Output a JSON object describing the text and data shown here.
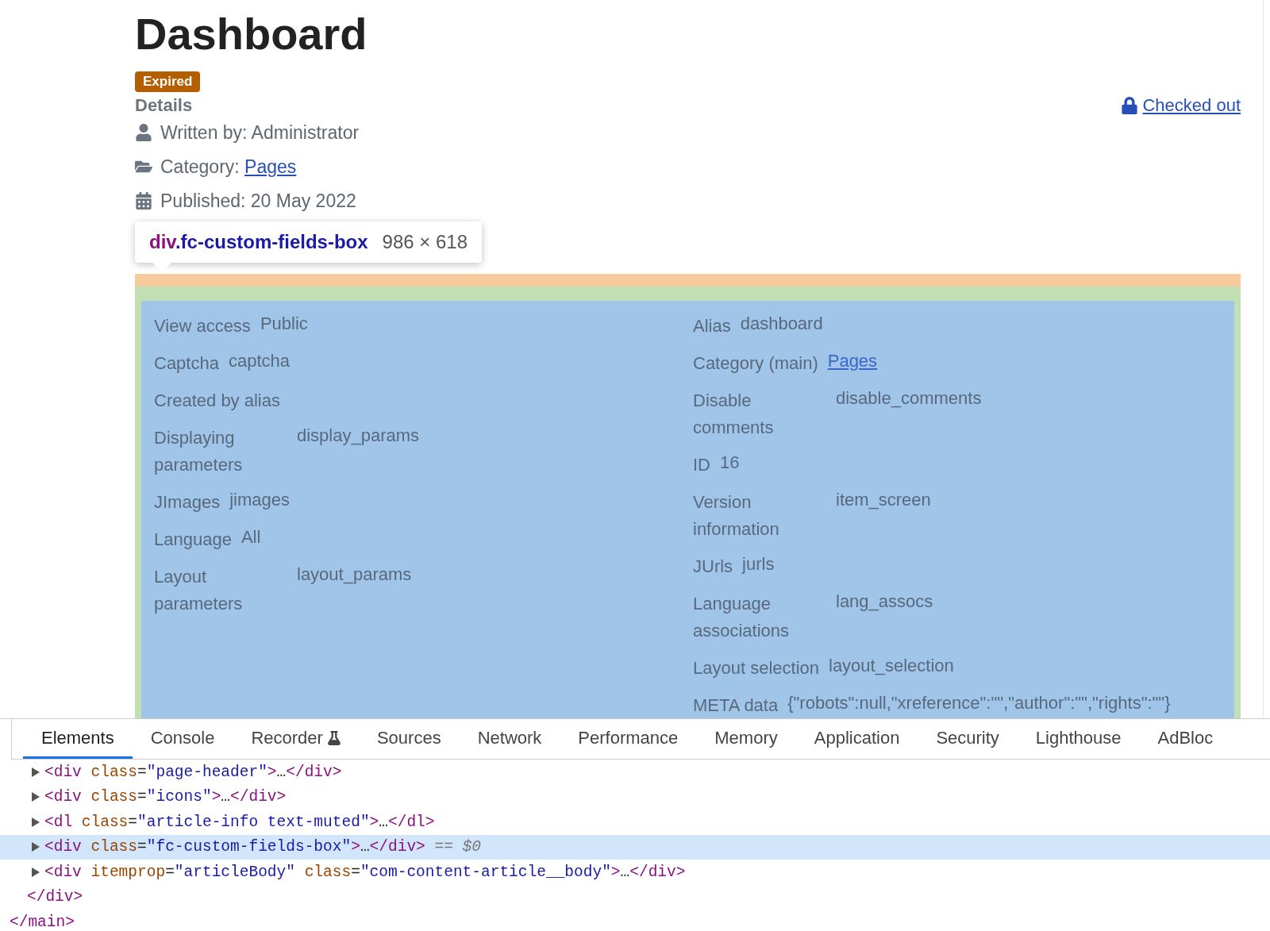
{
  "page": {
    "title": "Dashboard",
    "badge": "Expired",
    "details_heading": "Details",
    "checked_out": "Checked out",
    "info": [
      {
        "kind": "author",
        "text": "Written by: Administrator"
      },
      {
        "kind": "category",
        "text": "Category: ",
        "link": "Pages"
      },
      {
        "kind": "published",
        "text": "Published: 20 May 2022"
      }
    ]
  },
  "inspector_tooltip": {
    "tag": "div",
    "class_name": ".fc-custom-fields-box",
    "size": "986 × 618"
  },
  "custom_fields": {
    "left": [
      {
        "label": "View access",
        "value": "Public",
        "kind": "text"
      },
      {
        "label": "Captcha",
        "value": "captcha",
        "kind": "text"
      },
      {
        "label": "Created by alias",
        "kind": "empty"
      },
      {
        "label": "Displaying parameters",
        "value": "display_params",
        "kind": "text"
      },
      {
        "label": "JImages",
        "value": "jimages",
        "kind": "text"
      },
      {
        "label": "Language",
        "value": "All",
        "kind": "text"
      },
      {
        "label": "Layout parameters",
        "value": "layout_params",
        "kind": "text"
      }
    ],
    "right": [
      {
        "label": "Alias",
        "value": "dashboard",
        "kind": "text"
      },
      {
        "label": "Category (main)",
        "value": "Pages",
        "kind": "link"
      },
      {
        "label": "Disable comments",
        "value": "disable_comments",
        "kind": "text"
      },
      {
        "label": "ID",
        "value": "16",
        "kind": "text"
      },
      {
        "label": "Version information",
        "value": "item_screen",
        "kind": "text"
      },
      {
        "label": "JUrls",
        "value": "jurls",
        "kind": "text"
      },
      {
        "label": "Language associations",
        "value": "lang_assocs",
        "kind": "text"
      },
      {
        "label": "Layout selection",
        "value": "layout_selection",
        "kind": "text"
      },
      {
        "label": "META data",
        "value": "{\"robots\":null,\"xreference\":\"\",\"author\":\"\",\"rights\":\"\"}",
        "kind": "text"
      }
    ]
  },
  "devtools": {
    "tabs": [
      {
        "label": "Elements",
        "selected": true,
        "experimental": false
      },
      {
        "label": "Console",
        "selected": false,
        "experimental": false
      },
      {
        "label": "Recorder",
        "selected": false,
        "experimental": true
      },
      {
        "label": "Sources",
        "selected": false,
        "experimental": false
      },
      {
        "label": "Network",
        "selected": false,
        "experimental": false
      },
      {
        "label": "Performance",
        "selected": false,
        "experimental": false
      },
      {
        "label": "Memory",
        "selected": false,
        "experimental": false
      },
      {
        "label": "Application",
        "selected": false,
        "experimental": false
      },
      {
        "label": "Security",
        "selected": false,
        "experimental": false
      },
      {
        "label": "Lighthouse",
        "selected": false,
        "experimental": false
      },
      {
        "label": "AdBloc",
        "selected": false,
        "experimental": false
      }
    ],
    "dom_tree": {
      "closing": "</main>",
      "children": [
        {
          "closing": "</div>",
          "children": [
            {
              "selected": false,
              "expandable": true,
              "tokens": [
                {
                  "kind": "tag",
                  "text": "<div"
                },
                {
                  "kind": "attr",
                  "text": " class"
                },
                {
                  "kind": "punct",
                  "text": "="
                },
                {
                  "kind": "value",
                  "text": "\"page-header\""
                },
                {
                  "kind": "tag",
                  "text": ">"
                },
                {
                  "kind": "punct",
                  "text": "…"
                },
                {
                  "kind": "tag",
                  "text": "</div>"
                }
              ]
            },
            {
              "selected": false,
              "expandable": true,
              "tokens": [
                {
                  "kind": "tag",
                  "text": "<div"
                },
                {
                  "kind": "attr",
                  "text": " class"
                },
                {
                  "kind": "punct",
                  "text": "="
                },
                {
                  "kind": "value",
                  "text": "\"icons\""
                },
                {
                  "kind": "tag",
                  "text": ">"
                },
                {
                  "kind": "punct",
                  "text": "…"
                },
                {
                  "kind": "tag",
                  "text": "</div>"
                }
              ]
            },
            {
              "selected": false,
              "expandable": true,
              "tokens": [
                {
                  "kind": "tag",
                  "text": "<dl"
                },
                {
                  "kind": "attr",
                  "text": " class"
                },
                {
                  "kind": "punct",
                  "text": "="
                },
                {
                  "kind": "value",
                  "text": "\"article-info text-muted\""
                },
                {
                  "kind": "tag",
                  "text": ">"
                },
                {
                  "kind": "punct",
                  "text": "…"
                },
                {
                  "kind": "tag",
                  "text": "</dl>"
                }
              ]
            },
            {
              "selected": true,
              "expandable": true,
              "tokens": [
                {
                  "kind": "tag",
                  "text": "<div"
                },
                {
                  "kind": "attr",
                  "text": " class"
                },
                {
                  "kind": "punct",
                  "text": "="
                },
                {
                  "kind": "value",
                  "text": "\"fc-custom-fields-box\""
                },
                {
                  "kind": "tag",
                  "text": ">"
                },
                {
                  "kind": "punct",
                  "text": "…"
                },
                {
                  "kind": "tag",
                  "text": "</div>"
                },
                {
                  "kind": "note",
                  "text": " == $0"
                }
              ]
            },
            {
              "selected": false,
              "expandable": true,
              "tokens": [
                {
                  "kind": "tag",
                  "text": "<div"
                },
                {
                  "kind": "attr",
                  "text": " itemprop"
                },
                {
                  "kind": "punct",
                  "text": "="
                },
                {
                  "kind": "value",
                  "text": "\"articleBody\""
                },
                {
                  "kind": "attr",
                  "text": " class"
                },
                {
                  "kind": "punct",
                  "text": "="
                },
                {
                  "kind": "value",
                  "text": "\"com-content-article__body\""
                },
                {
                  "kind": "tag",
                  "text": ">"
                },
                {
                  "kind": "punct",
                  "text": "…"
                },
                {
                  "kind": "tag",
                  "text": "</div>"
                }
              ]
            }
          ]
        }
      ]
    }
  }
}
